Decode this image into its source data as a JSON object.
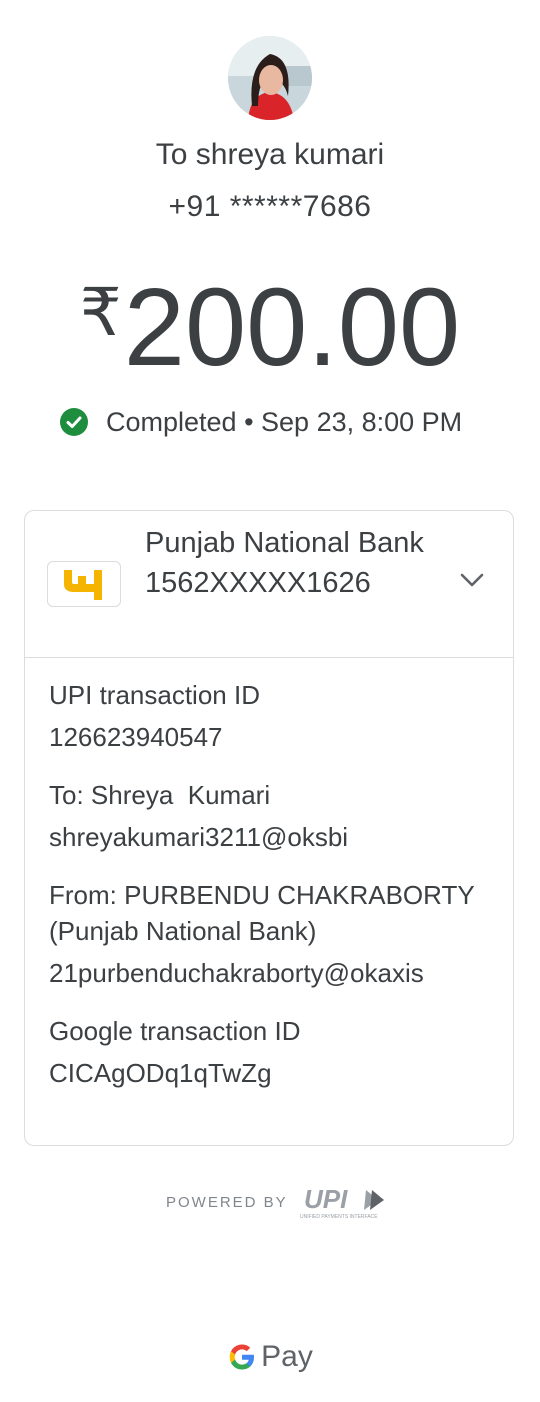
{
  "recipient": {
    "to_label": "To shreya kumari",
    "phone": "+91 ******7686"
  },
  "payment": {
    "currency_symbol": "₹",
    "amount": "200.00",
    "status_text": "Completed • Sep 23, 8:00 PM",
    "status_color": "#1e8e3e"
  },
  "bank": {
    "name": "Punjab National Bank",
    "account": "1562XXXXX1626",
    "logo_icon": "punjab-national-bank-logo"
  },
  "details": [
    {
      "label": "UPI transaction ID",
      "value": "126623940547"
    },
    {
      "label": "To: Shreya  Kumari",
      "value": "shreyakumari3211@oksbi"
    },
    {
      "label": "From: PURBENDU CHAKRABORTY (Punjab National Bank)",
      "value": "21purbenduchakraborty@okaxis"
    },
    {
      "label": "Google transaction ID",
      "value": "CICAgODq1qTwZg"
    }
  ],
  "footer": {
    "powered_by": "POWERED BY",
    "upi_logo_text": "UPI",
    "upi_tagline": "UNIFIED PAYMENTS INTERFACE",
    "brand": "Pay"
  }
}
